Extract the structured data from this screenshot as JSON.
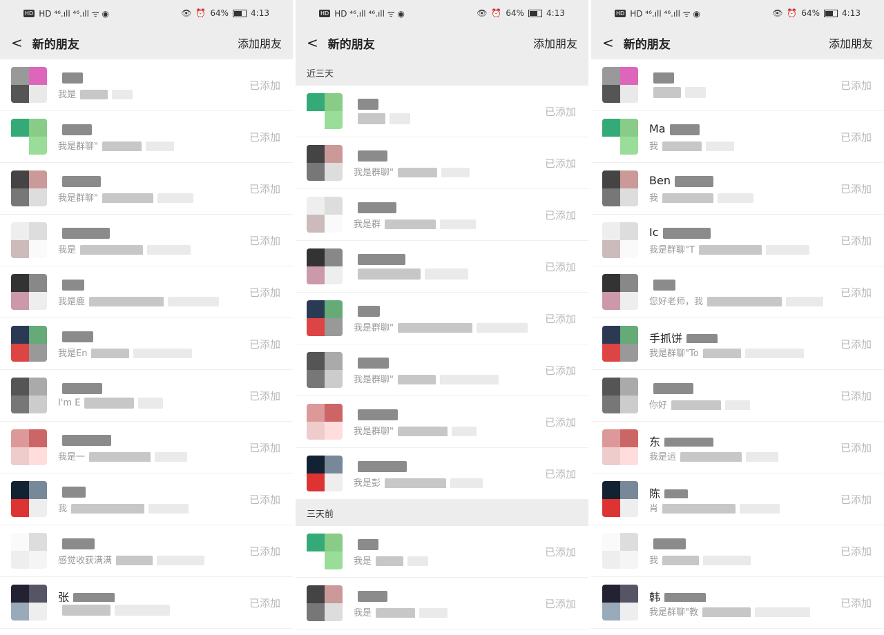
{
  "status_bar": {
    "left": "HD  ⁴⁶.ıll ⁴⁶.ıll ᯤ ◉",
    "battery": "64%",
    "time": "4:13"
  },
  "header": {
    "back": "<",
    "title": "新的朋友",
    "action": "添加朋友"
  },
  "colors": {
    "bg": "#ffffff",
    "section_bg": "#ededed",
    "status_text": "#b8b8b8"
  },
  "panels": [
    {
      "items": [
        {
          "name": "",
          "msg": "我是",
          "status": "已添加"
        },
        {
          "name": "",
          "msg": "我是群聊\"",
          "status": "已添加"
        },
        {
          "name": "",
          "msg": "我是群聊\"",
          "status": "已添加"
        },
        {
          "name": "",
          "msg": "我是",
          "status": "已添加"
        },
        {
          "name": "",
          "msg": "我是鹿",
          "status": "已添加"
        },
        {
          "name": "",
          "msg": "我是En",
          "status": "已添加"
        },
        {
          "name": "",
          "msg": "I'm E",
          "status": "已添加"
        },
        {
          "name": "",
          "msg": "我是一",
          "status": "已添加"
        },
        {
          "name": "",
          "msg": "我",
          "status": "已添加"
        },
        {
          "name": "",
          "msg": "感觉收获满满",
          "status": "已添加"
        },
        {
          "name": "张",
          "msg": "",
          "status": "已添加"
        }
      ]
    },
    {
      "sections": {
        "recent": "近三天",
        "older": "三天前"
      },
      "items_recent": [
        {
          "name": "",
          "msg": "",
          "status": "已添加"
        },
        {
          "name": "",
          "msg": "我是群聊\"",
          "status": "已添加"
        },
        {
          "name": "",
          "msg": "我是群",
          "status": "已添加"
        },
        {
          "name": "",
          "msg": "",
          "status": "已添加"
        },
        {
          "name": "",
          "msg": "我是群聊\"",
          "status": "已添加"
        },
        {
          "name": "",
          "msg": "我是群聊\"",
          "status": "已添加"
        },
        {
          "name": "",
          "msg": "我是群聊\"",
          "status": "已添加"
        },
        {
          "name": "",
          "msg": "我是彭",
          "status": "已添加"
        }
      ],
      "items_older": [
        {
          "name": "",
          "msg": "我是",
          "status": "已添加"
        },
        {
          "name": "",
          "msg": "我是",
          "status": "已添加"
        }
      ]
    },
    {
      "items": [
        {
          "name": "",
          "msg": "",
          "status": "已添加"
        },
        {
          "name": "Ma",
          "msg": "我",
          "status": "已添加"
        },
        {
          "name": "Ben",
          "msg": "我",
          "status": "已添加"
        },
        {
          "name": "Ic",
          "msg": "我是群聊\"T",
          "status": "已添加"
        },
        {
          "name": "",
          "msg": "您好老师，我",
          "status": "已添加"
        },
        {
          "name": "手抓饼",
          "msg": "我是群聊\"To",
          "status": "已添加"
        },
        {
          "name": "",
          "msg": "你好",
          "status": "已添加"
        },
        {
          "name": "东",
          "msg": "我是运",
          "status": "已添加"
        },
        {
          "name": "陈",
          "msg": "肖",
          "status": "已添加"
        },
        {
          "name": "",
          "msg": "我",
          "status": "已添加"
        },
        {
          "name": "韩",
          "msg": "我是群聊\"教",
          "status": "已添加"
        }
      ]
    }
  ]
}
